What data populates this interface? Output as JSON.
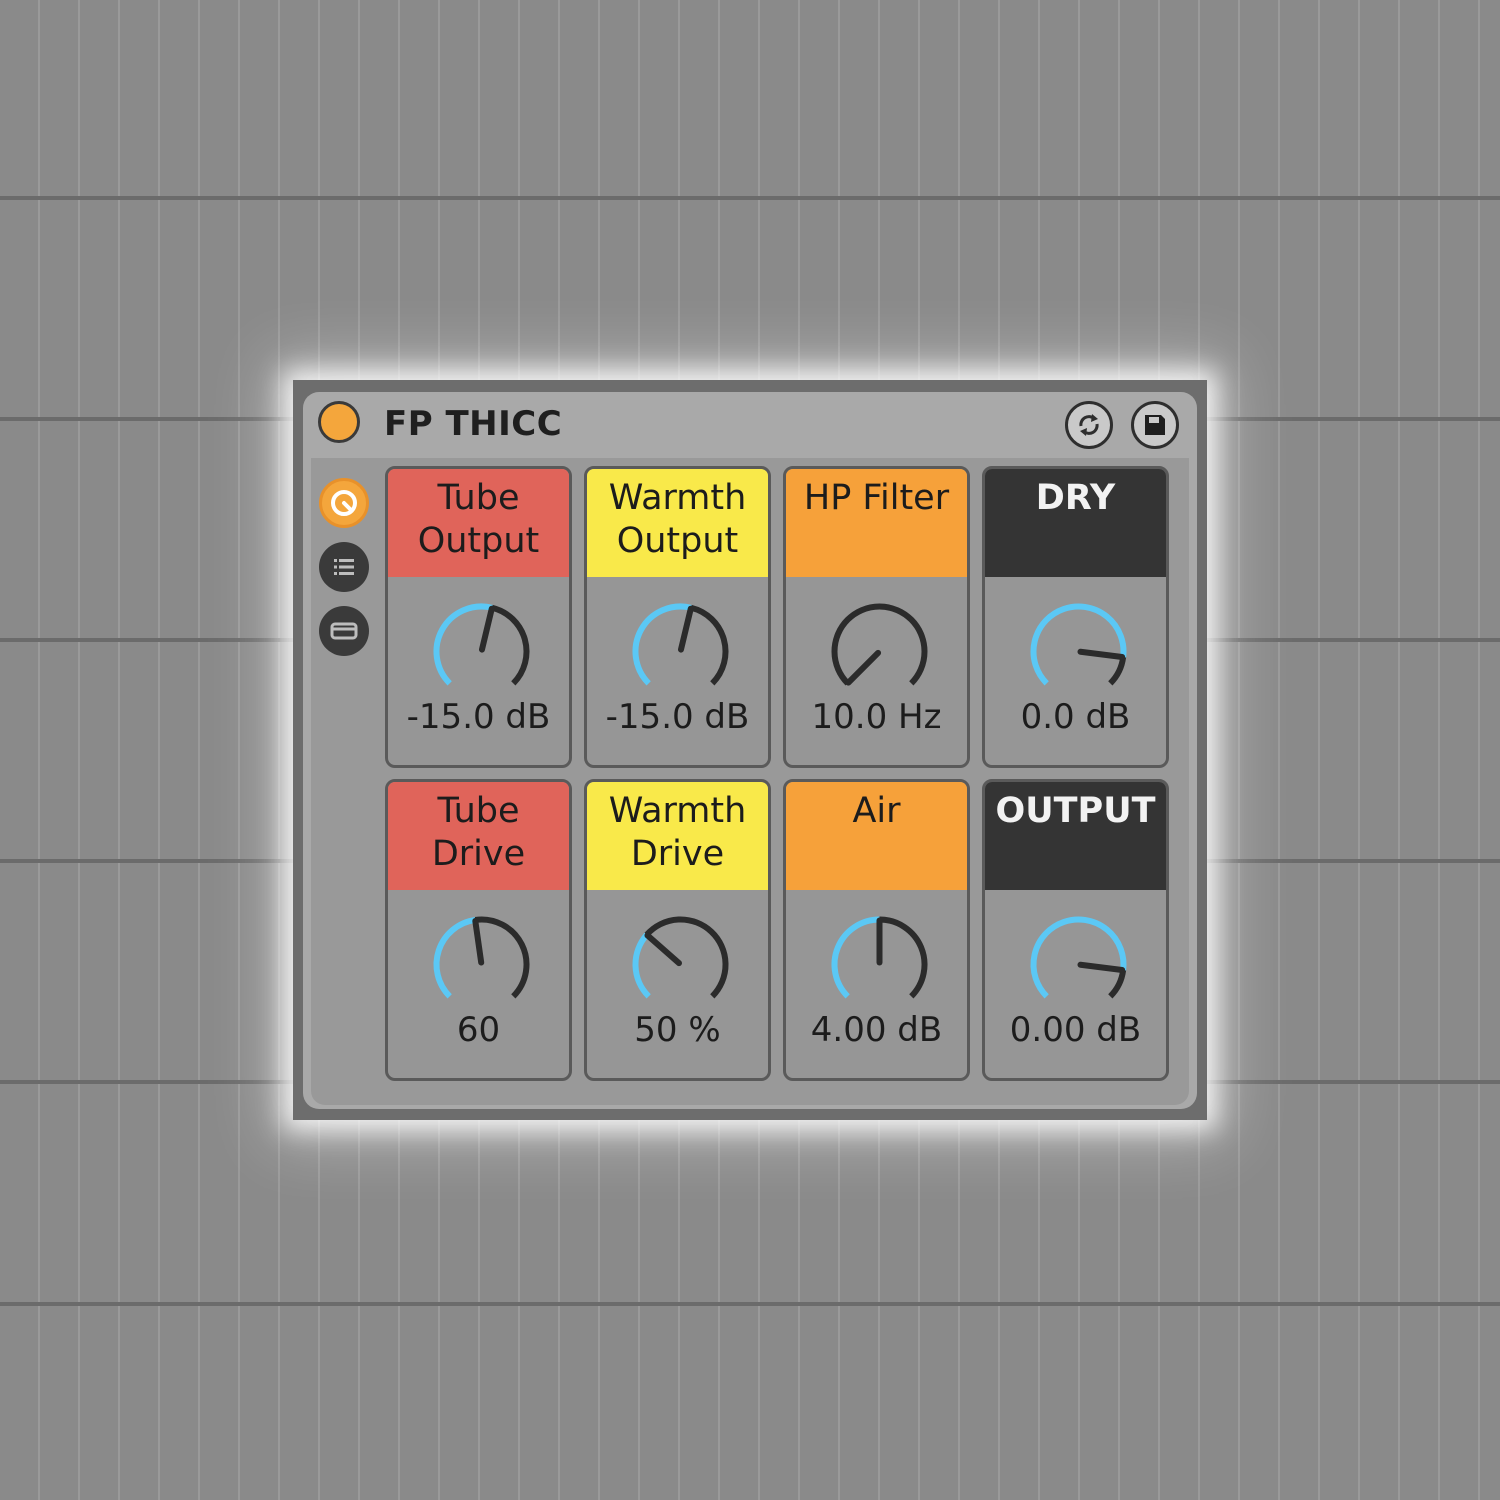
{
  "device": {
    "title": "FP THICC",
    "colors": {
      "power": "#f4a63c",
      "knob_arc": "#5bc8f5",
      "knob_track": "#2b2b2b"
    },
    "title_buttons": [
      {
        "icon": "hot-swap-icon"
      },
      {
        "icon": "save-icon"
      }
    ],
    "sidebar": [
      {
        "icon": "device-view-icon",
        "active": true
      },
      {
        "icon": "list-icon",
        "active": false
      },
      {
        "icon": "panel-icon",
        "active": false
      }
    ]
  },
  "controls": [
    {
      "label": "Tube\nOutput",
      "value": "-15.0 dB",
      "color": "#e0645a",
      "level": 0.55
    },
    {
      "label": "Warmth\nOutput",
      "value": "-15.0 dB",
      "color": "#f9e94a",
      "level": 0.55
    },
    {
      "label": "HP Filter",
      "value": "10.0 Hz",
      "color": "#f6a13a",
      "level": 0.0
    },
    {
      "label": "DRY",
      "value": "0.0 dB",
      "color": "#343434",
      "level": 0.86
    },
    {
      "label": "Tube\nDrive",
      "value": "60",
      "color": "#e0645a",
      "level": 0.47
    },
    {
      "label": "Warmth\nDrive",
      "value": "50 %",
      "color": "#f9e94a",
      "level": 0.32
    },
    {
      "label": "Air",
      "value": "4.00 dB",
      "color": "#f6a13a",
      "level": 0.5
    },
    {
      "label": "OUTPUT",
      "value": "0.00 dB",
      "color": "#343434",
      "level": 0.86
    }
  ]
}
